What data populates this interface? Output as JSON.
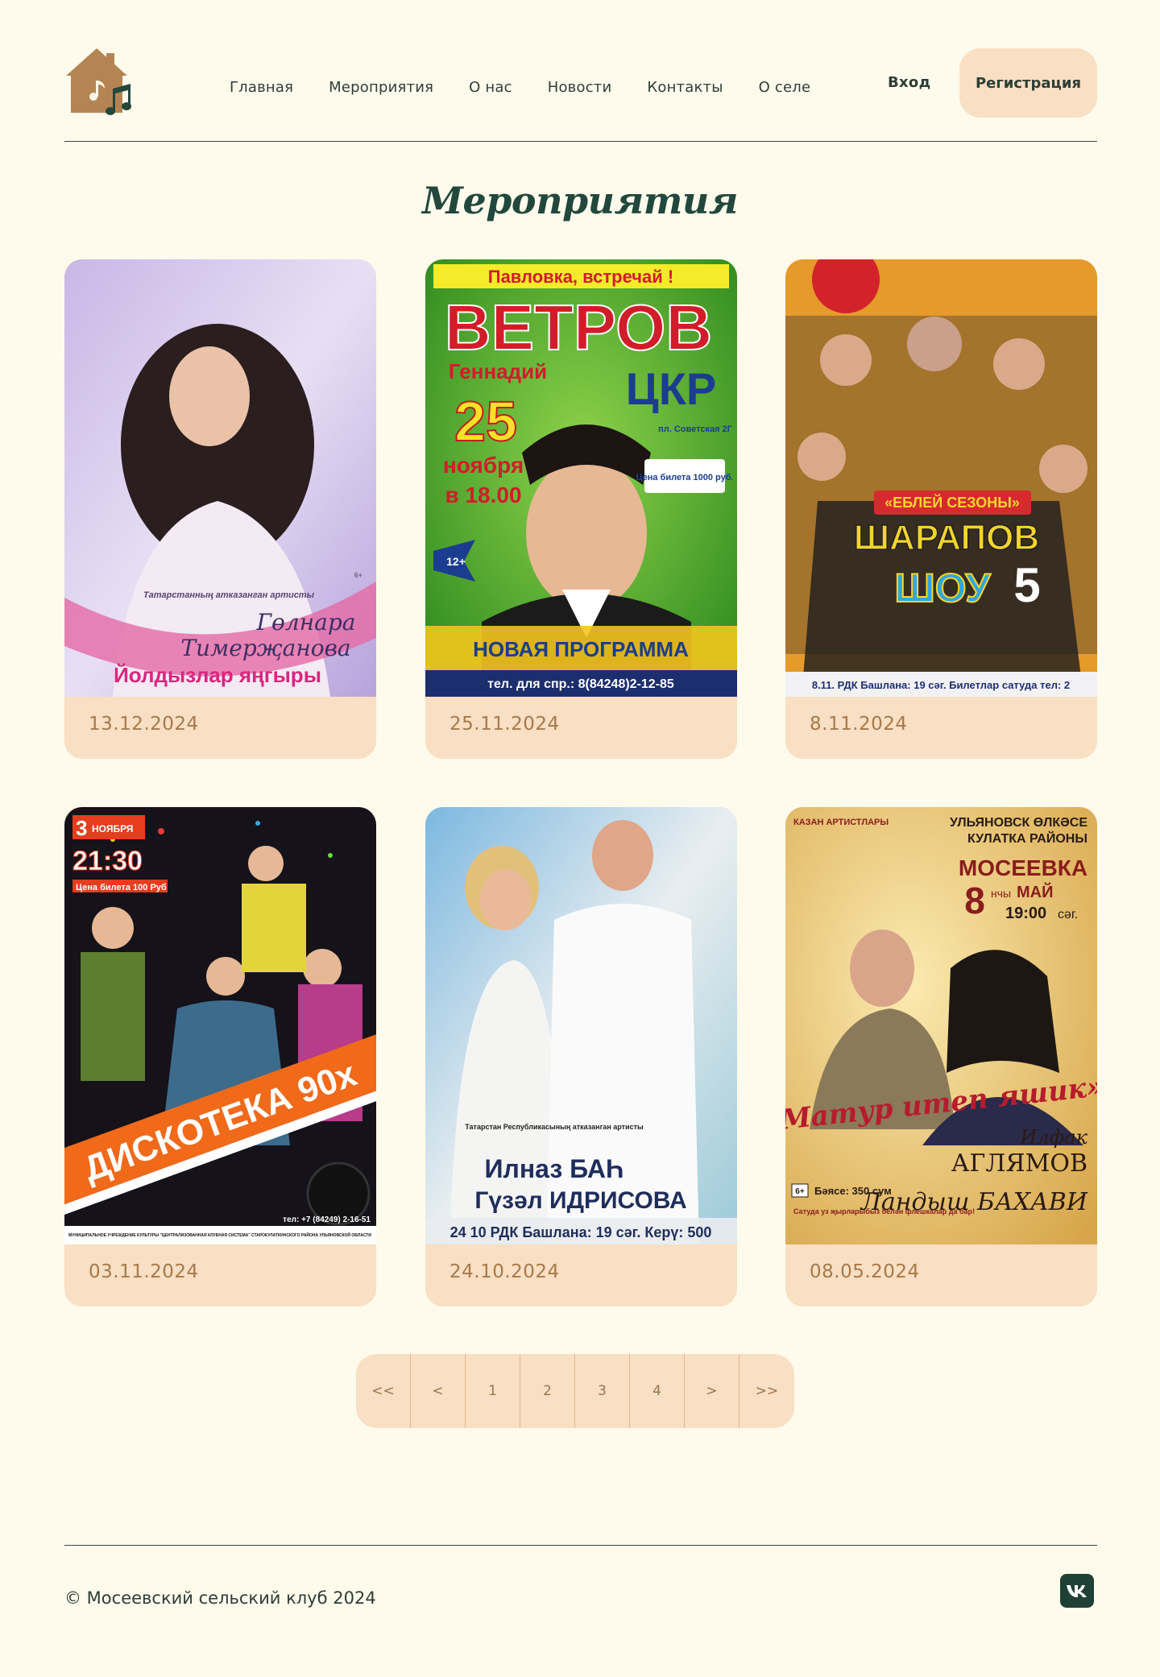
{
  "brand": {
    "logo_icon": "house-music-icon"
  },
  "nav": {
    "items": [
      "Главная",
      "Мероприятия",
      "О нас",
      "Новости",
      "Контакты",
      "О селе"
    ]
  },
  "auth": {
    "login": "Вход",
    "register": "Регистрация"
  },
  "page": {
    "title": "Мероприятия"
  },
  "events": [
    {
      "date": "13.12.2024",
      "poster": {
        "line1": "Татарстанның атказанган артисты",
        "name1": "Гөлнара",
        "name2": "Тимерҗанова",
        "title": "Йолдызлар яңгыры",
        "age": "6+"
      }
    },
    {
      "date": "25.11.2024",
      "poster": {
        "banner": "Павловка, встречай !",
        "surname": "ВЕТРОВ",
        "firstname": "Геннадий",
        "venue": "ЦКР",
        "venue_addr": "пл. Советская 2Г",
        "day": "25",
        "month": "ноября",
        "time": "в 18.00",
        "price": "Цена билета 1000 руб.",
        "age": "12+",
        "program": "НОВАЯ ПРОГРАММА",
        "phone": "тел. для спр.: 8(84248)2-12-85"
      }
    },
    {
      "date": "8.11.2024",
      "poster": {
        "season": "«ЕБЛЕЙ СЕЗОНЫ»",
        "show1": "ШАРАПОВ",
        "show2": "ШОУ",
        "show_num": "5",
        "footer": "8.11. РДК Башлана: 19 сәг. Билетлар сатуда тел: 2"
      }
    },
    {
      "date": "03.11.2024",
      "poster": {
        "day": "3",
        "month": "НОЯБРЯ",
        "time": "21:30",
        "price": "Цена билета 100 Руб",
        "title": "ДИСКОТЕКА 90х",
        "phone": "тел: +7 (84249) 2-16-51",
        "org": "МУНИЦИПАЛЬНОЕ УЧРЕЖДЕНИЕ КУЛЬТУРЫ \"ЦЕНТРАЛИЗОВАННАЯ КЛУБНАЯ СИСТЕМА\" СТАРОКУЛАТКИНСКОГО РАЙОНА УЛЬЯНОВСКОЙ ОБЛАСТИ"
      }
    },
    {
      "date": "24.10.2024",
      "poster": {
        "line1": "Татарстан Республикасының атказанган артисты",
        "name1": "Илназ БАҺ",
        "name2": "Гүзәл ИДРИСОВА",
        "footer": "24 10 РДК Башлана: 19 сәг. Керү: 500"
      }
    },
    {
      "date": "08.05.2024",
      "poster": {
        "top_left": "КАЗАН АРТИСТЛАРЫ",
        "region1": "УЛЬЯНОВСК ӨЛКӘСЕ",
        "region2": "КУЛАТКА РАЙОНЫ",
        "village": "МОСЕЕВКА",
        "day": "8",
        "day_suffix": "нчы",
        "month": "МАЙ",
        "time": "19:00",
        "time_suffix": "сәг.",
        "title": "«Матур итеп яшик»",
        "artist1_first": "Илфак",
        "artist1_last": "АГЛЯМОВ",
        "artist2": "Ландыш БАХАВИ",
        "age": "6+",
        "price": "Бәясе: 350 сум",
        "note": "Сатуда уз җырларыбыз белән флешкалар да бар!"
      }
    }
  ],
  "pagination": [
    "<<",
    "<",
    "1",
    "2",
    "3",
    "4",
    ">",
    ">>"
  ],
  "footer": {
    "copyright": "© Мосеевский сельский клуб 2024",
    "social_icon": "vk-icon"
  },
  "colors": {
    "background": "#fefbec",
    "card": "#f9dfc3",
    "accent_dark": "#22473c",
    "date_text": "#a7794b"
  }
}
